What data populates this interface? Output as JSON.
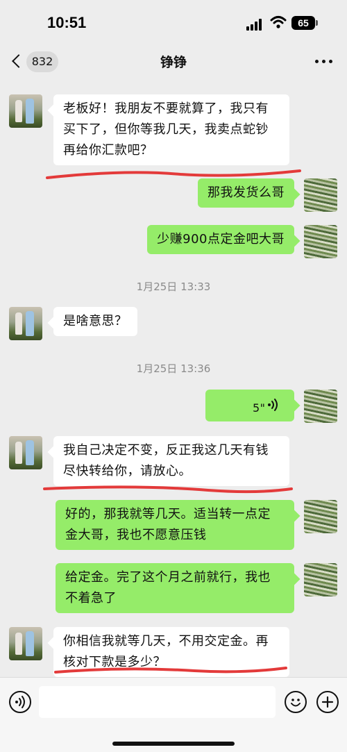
{
  "status_bar": {
    "time": "10:51",
    "battery": "65"
  },
  "header": {
    "back_count": "832",
    "title": "铮铮"
  },
  "messages": [
    {
      "side": "left",
      "lines": [
        "老板好！我朋友不要就算了，我只有",
        "买下了，但你等我几天，我卖点蛇钞",
        "再给你汇款吧？"
      ]
    },
    {
      "side": "right",
      "lines": [
        "那我发货么哥"
      ]
    },
    {
      "side": "right",
      "lines": [
        "少赚900点定金吧大哥"
      ]
    },
    {
      "type": "time",
      "text": "1月25日 13:33"
    },
    {
      "side": "left",
      "lines": [
        "是啥意思？"
      ]
    },
    {
      "type": "time",
      "text": "1月25日 13:36"
    },
    {
      "side": "right",
      "type": "voice",
      "duration": "5\""
    },
    {
      "side": "left",
      "lines": [
        "我自己决定不变，反正我这几天有钱",
        "尽快转给你，请放心。"
      ]
    },
    {
      "side": "right",
      "lines": [
        "好的，那我就等几天。适当转一点定",
        "金大哥，我也不愿意压钱"
      ]
    },
    {
      "side": "right",
      "lines": [
        "给定金。完了这个月之前就行，我也",
        "不着急了"
      ]
    },
    {
      "side": "left",
      "lines": [
        "你相信我就等几天，不用交定金。再",
        "核对下款是多少？"
      ]
    }
  ],
  "colors": {
    "background": "#ededed",
    "bubble_self": "#95ec69",
    "bubble_other": "#ffffff",
    "annotation_underline": "#e33a3a"
  },
  "icons": [
    "back-chevron-icon",
    "more-icon",
    "voice-mode-icon",
    "emoji-icon",
    "add-icon",
    "voice-wave-icon"
  ]
}
